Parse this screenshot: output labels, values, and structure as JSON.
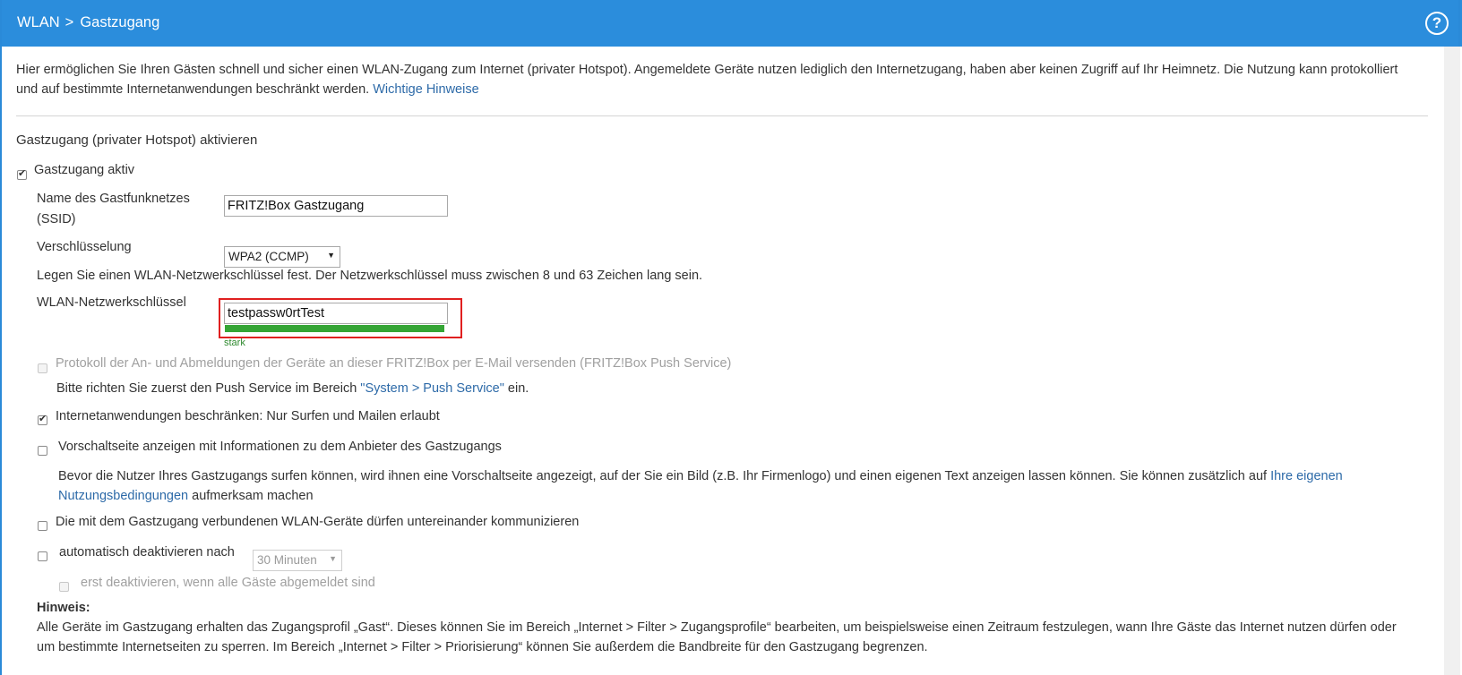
{
  "header": {
    "crumb1": "WLAN",
    "separator": ">",
    "crumb2": "Gastzugang",
    "help": "?"
  },
  "intro": {
    "line1": "Hier ermöglichen Sie Ihren Gästen schnell und sicher einen WLAN-Zugang zum Internet (privater Hotspot). Angemeldete Geräte nutzen lediglich den Internetzugang, haben aber keinen Zugriff auf Ihr Heimnetz. Die Nutzung kann protokolliert",
    "line2": "und auf bestimmte Internetanwendungen beschränkt werden.",
    "link": "Wichtige Hinweise"
  },
  "section_title": "Gastzugang (privater Hotspot) aktivieren",
  "active": {
    "label": "Gastzugang aktiv",
    "checked": true
  },
  "ssid": {
    "label1": "Name des Gastfunknetzes",
    "label2": "(SSID)",
    "value": "FRITZ!Box Gastzugang"
  },
  "encryption": {
    "label": "Verschlüsselung",
    "value": "WPA2 (CCMP)"
  },
  "key_hint": "Legen Sie einen WLAN-Netzwerkschlüssel fest. Der Netzwerkschlüssel muss zwischen 8 und 63 Zeichen lang sein.",
  "key": {
    "label": "WLAN-Netzwerkschlüssel",
    "value": "testpassw0rtTest",
    "strength": "stark",
    "strength_fraction": 1.0
  },
  "push": {
    "label": "Protokoll der An- und Abmeldungen der Geräte an dieser FRITZ!Box per E-Mail versenden (FRITZ!Box Push Service)",
    "hint_before": "Bitte richten Sie zuerst den Push Service im Bereich ",
    "hint_link": "\"System > Push Service\"",
    "hint_after": " ein."
  },
  "restrict": {
    "label": "Internetanwendungen beschränken: Nur Surfen und Mailen erlaubt",
    "checked": true
  },
  "splash": {
    "label": "Vorschaltseite anzeigen mit Informationen zu dem Anbieter des Gastzugangs",
    "desc1": "Bevor die Nutzer Ihres Gastzugangs surfen können, wird ihnen eine Vorschaltseite angezeigt, auf der Sie ein Bild (z.B. Ihr Firmenlogo) und einen eigenen Text anzeigen lassen können. Sie können zusätzlich auf",
    "desc_link1": "Ihre eigenen",
    "desc_link2": "Nutzungsbedingungen",
    "desc2": " aufmerksam machen"
  },
  "communicate": {
    "label": "Die mit dem Gastzugang verbundenen WLAN-Geräte dürfen untereinander kommunizieren"
  },
  "auto_off": {
    "label": "automatisch deaktivieren nach",
    "value": "30 Minuten"
  },
  "auto_off_sub": {
    "label": "erst deaktivieren, wenn alle Gäste abgemeldet sind"
  },
  "note": {
    "title": "Hinweis:",
    "line1": "Alle Geräte im Gastzugang erhalten das Zugangsprofil „Gast“. Dieses können Sie im Bereich „Internet > Filter > Zugangsprofile“ bearbeiten, um beispielsweise einen Zeitraum festzulegen, wann Ihre Gäste das Internet nutzen dürfen oder",
    "line2": "um bestimmte Internetseiten zu sperren. Im Bereich „Internet > Filter > Priorisierung“ können Sie außerdem die Bandbreite für den Gastzugang begrenzen."
  }
}
